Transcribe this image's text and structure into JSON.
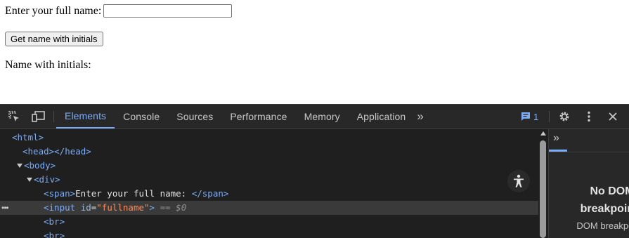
{
  "page": {
    "name_label": "Enter your full name:",
    "name_value": "",
    "button_label": "Get name with initials",
    "result_label": "Name with initials:"
  },
  "devtools": {
    "tabs": [
      "Elements",
      "Console",
      "Sources",
      "Performance",
      "Memory",
      "Application"
    ],
    "active_tab": "Elements",
    "more_tabs": "»",
    "issues_count": "1",
    "dom_lines": [
      {
        "html": "<html>"
      },
      {
        "head": "<head></head>"
      },
      {
        "body": "<body>"
      },
      {
        "div": "<div>"
      }
    ],
    "dom": {
      "html": "<html>",
      "head": "<head></head>",
      "body": "<body>",
      "div": "<div>",
      "span_open": "<span>",
      "span_text": "Enter your full name: ",
      "span_close": "</span>",
      "input_open": "<input ",
      "input_attr": "id",
      "input_eq": "=",
      "input_val": "\"fullname\"",
      "input_close": ">",
      "selected_marker": " == $0",
      "br1": "<br>",
      "br2": "<br>"
    },
    "sidebar": {
      "title_line1": "No DOM",
      "title_line2": "breakpoints",
      "subtitle": "DOM breakpoints"
    },
    "colors": {
      "accent": "#7cacf8",
      "background": "#1f1f1f",
      "tag": "#7cacf8",
      "attr_value": "#fc8c5c"
    }
  }
}
